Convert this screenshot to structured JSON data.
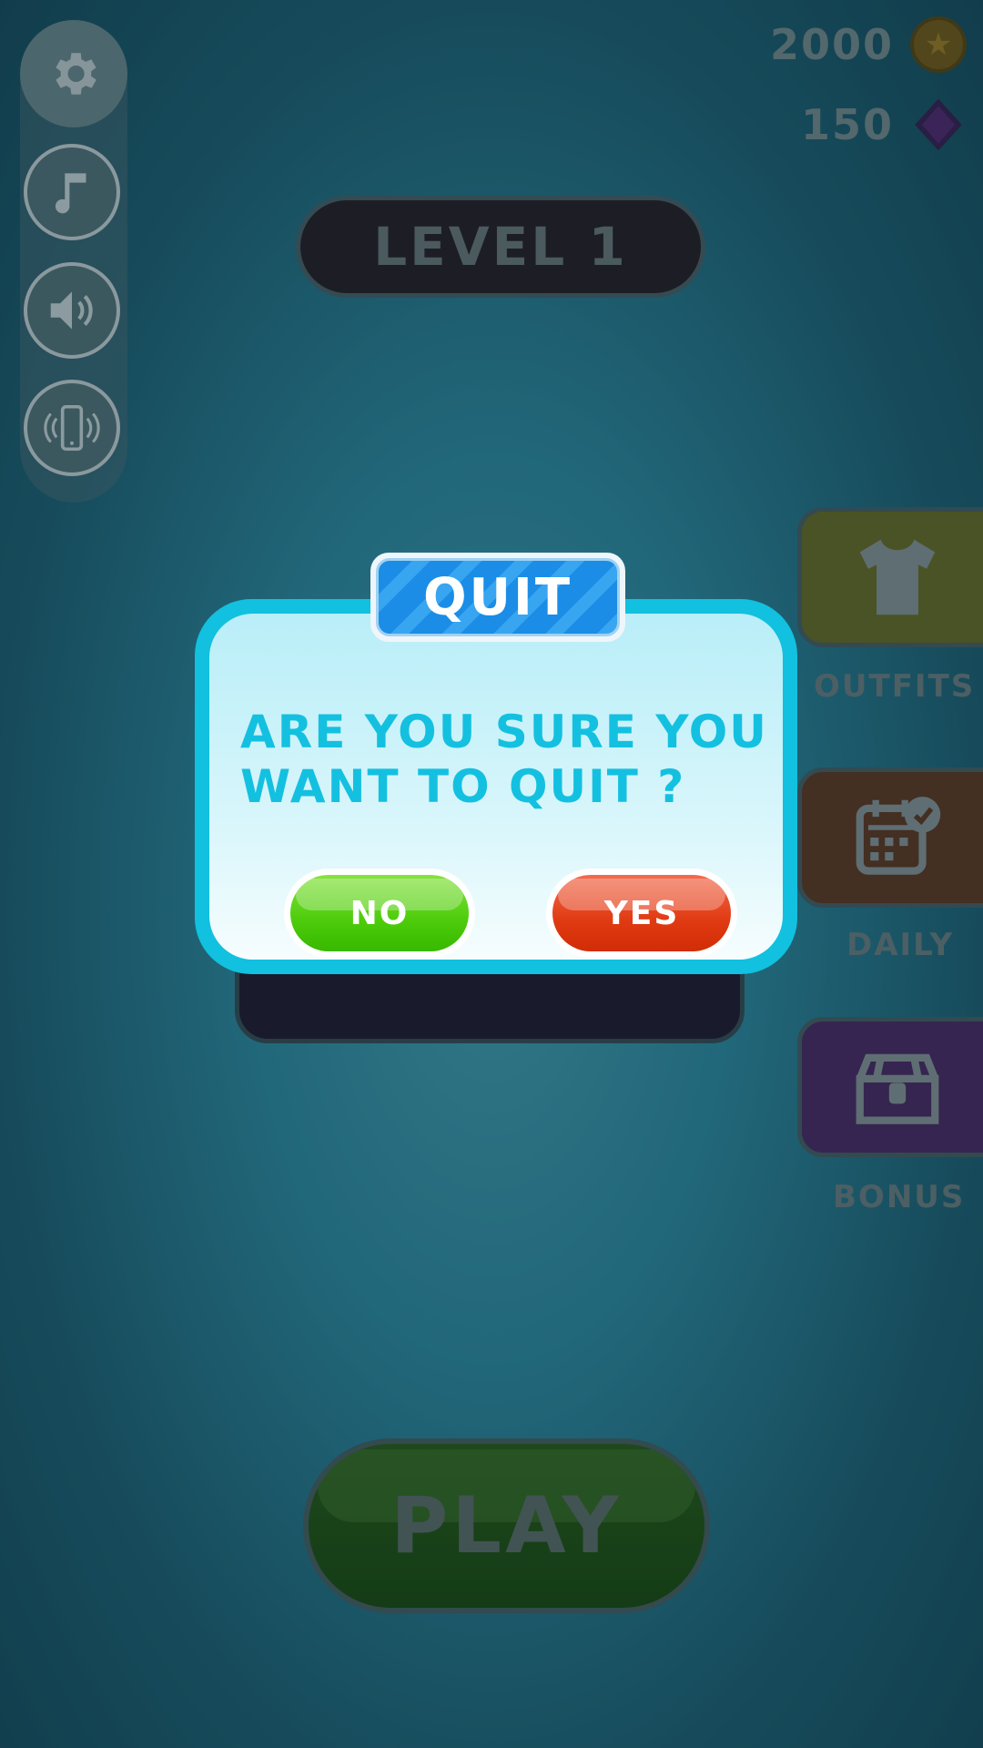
{
  "header": {
    "coins": "2000",
    "gems": "150",
    "level_label": "LEVEL 1"
  },
  "side_menu": {
    "outfits_label": "OUTFITS",
    "daily_label": "DAILY",
    "bonus_label": "BONUS"
  },
  "play_label": "PLAY",
  "dialog": {
    "title": "QUIT",
    "question": "ARE YOU SURE YOU WANT TO QUIT ?",
    "no_label": "NO",
    "yes_label": "YES"
  },
  "icons": {
    "settings": "gear-icon",
    "music": "music-note-icon",
    "sound": "speaker-icon",
    "vibration": "phone-vibrate-icon",
    "coin": "coin-icon",
    "gem": "gem-icon",
    "outfits": "tshirt-icon",
    "daily": "calendar-clock-icon",
    "bonus": "treasure-chest-icon"
  },
  "colors": {
    "dialog_border": "#12c0df",
    "title_tab": "#1b8de6",
    "no_button": "#4ccc0a",
    "yes_button": "#e03a12",
    "outfits_button": "#8a8a2a",
    "daily_button": "#7a3c22",
    "bonus_button": "#5b2a6d"
  }
}
